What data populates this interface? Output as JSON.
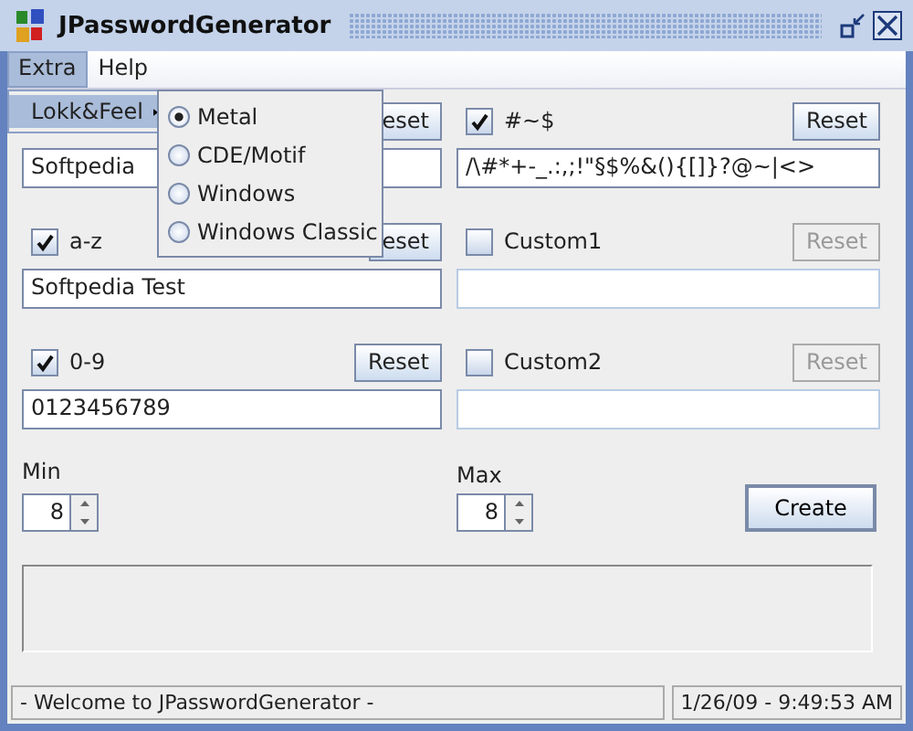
{
  "window": {
    "title": "JPasswordGenerator"
  },
  "menu_bar": [
    {
      "label": "Extra",
      "selected": true
    },
    {
      "label": "Help",
      "selected": false
    }
  ],
  "menu": [
    {
      "label": "Lokk&Feel",
      "selected": true,
      "submenu": [
        {
          "label": "Metal",
          "selected": true
        },
        {
          "label": "CDE/Motif",
          "selected": false
        },
        {
          "label": "Windows",
          "selected": false
        },
        {
          "label": "Windows Classic",
          "selected": false
        }
      ]
    }
  ],
  "groups": [
    {
      "reset": {
        "label": "eset",
        "disabled": false
      },
      "value": "Softpedia"
    },
    {
      "checked": true,
      "label": "#~$",
      "reset": {
        "label": "Reset",
        "disabled": false
      },
      "value": "/\\#*+-_.:,;!\"§$%&(){[]}?@~|<>"
    },
    {
      "checked": true,
      "label": "a-z",
      "reset": {
        "label": "eset",
        "disabled": false
      },
      "value": "Softpedia Test"
    },
    {
      "checked": false,
      "label": "Custom1",
      "reset": {
        "label": "Reset",
        "disabled": true
      }
    },
    {
      "checked": true,
      "label": "0-9",
      "reset": {
        "label": "Reset",
        "disabled": false
      },
      "value": "0123456789"
    },
    {
      "checked": false,
      "label": "Custom2",
      "reset": {
        "label": "Reset",
        "disabled": true
      }
    }
  ],
  "min": {
    "label": "Min",
    "value": "8"
  },
  "max": {
    "label": "Max",
    "value": "8"
  },
  "create_button": "Create",
  "status_bar": {
    "message": "- Welcome to JPasswordGenerator -",
    "time": "1/26/09 - 9:49:53 AM"
  }
}
